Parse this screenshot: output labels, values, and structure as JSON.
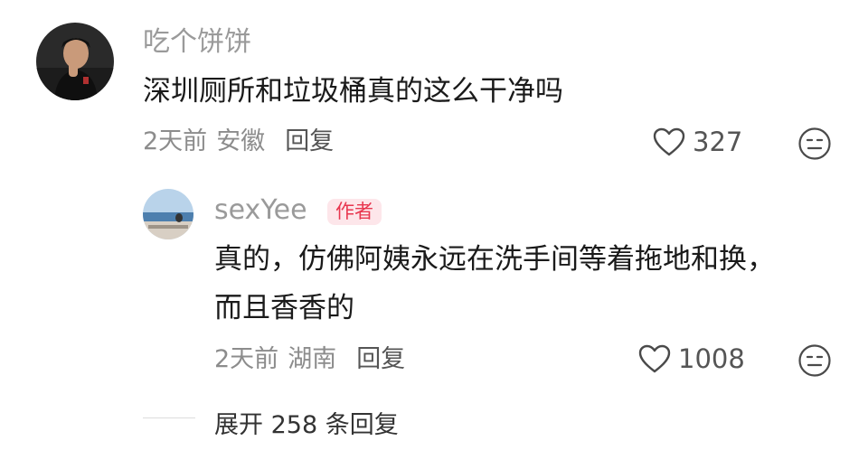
{
  "comment": {
    "author": "吃个饼饼",
    "text": "深圳厕所和垃圾桶真的这么干净吗",
    "time": "2天前",
    "location": "安徽",
    "reply_label": "回复",
    "likes": "327"
  },
  "reply": {
    "author": "sexYee",
    "badge": "作者",
    "text_line1": "真的，仿佛阿姨永远在洗手间等着拖地和换，",
    "text_line2": "而且香香的",
    "time": "2天前",
    "location": "湖南",
    "reply_label": "回复",
    "likes": "1008"
  },
  "expand_label": "展开 258 条回复",
  "colors": {
    "badge_bg": "#fde6ea",
    "badge_text": "#e8364f"
  }
}
